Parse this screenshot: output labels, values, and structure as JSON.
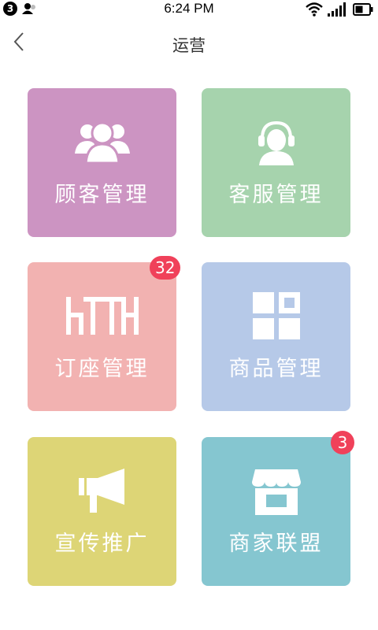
{
  "status_bar": {
    "notification_count": "3",
    "time": "6:24 PM"
  },
  "header": {
    "title": "运营"
  },
  "tiles": [
    {
      "label": "顾客管理",
      "color": "#cc94c2",
      "icon": "users-icon"
    },
    {
      "label": "客服管理",
      "color": "#a6d3ad",
      "icon": "headset-agent-icon"
    },
    {
      "label": "订座管理",
      "color": "#f2b2b1",
      "icon": "htth-logo-icon",
      "badge": "32"
    },
    {
      "label": "商品管理",
      "color": "#b6c9e8",
      "icon": "grid-blocks-icon"
    },
    {
      "label": "宣传推广",
      "color": "#ddd576",
      "icon": "megaphone-icon"
    },
    {
      "label": "商家联盟",
      "color": "#85c6d0",
      "icon": "storefront-icon",
      "badge": "3"
    }
  ]
}
